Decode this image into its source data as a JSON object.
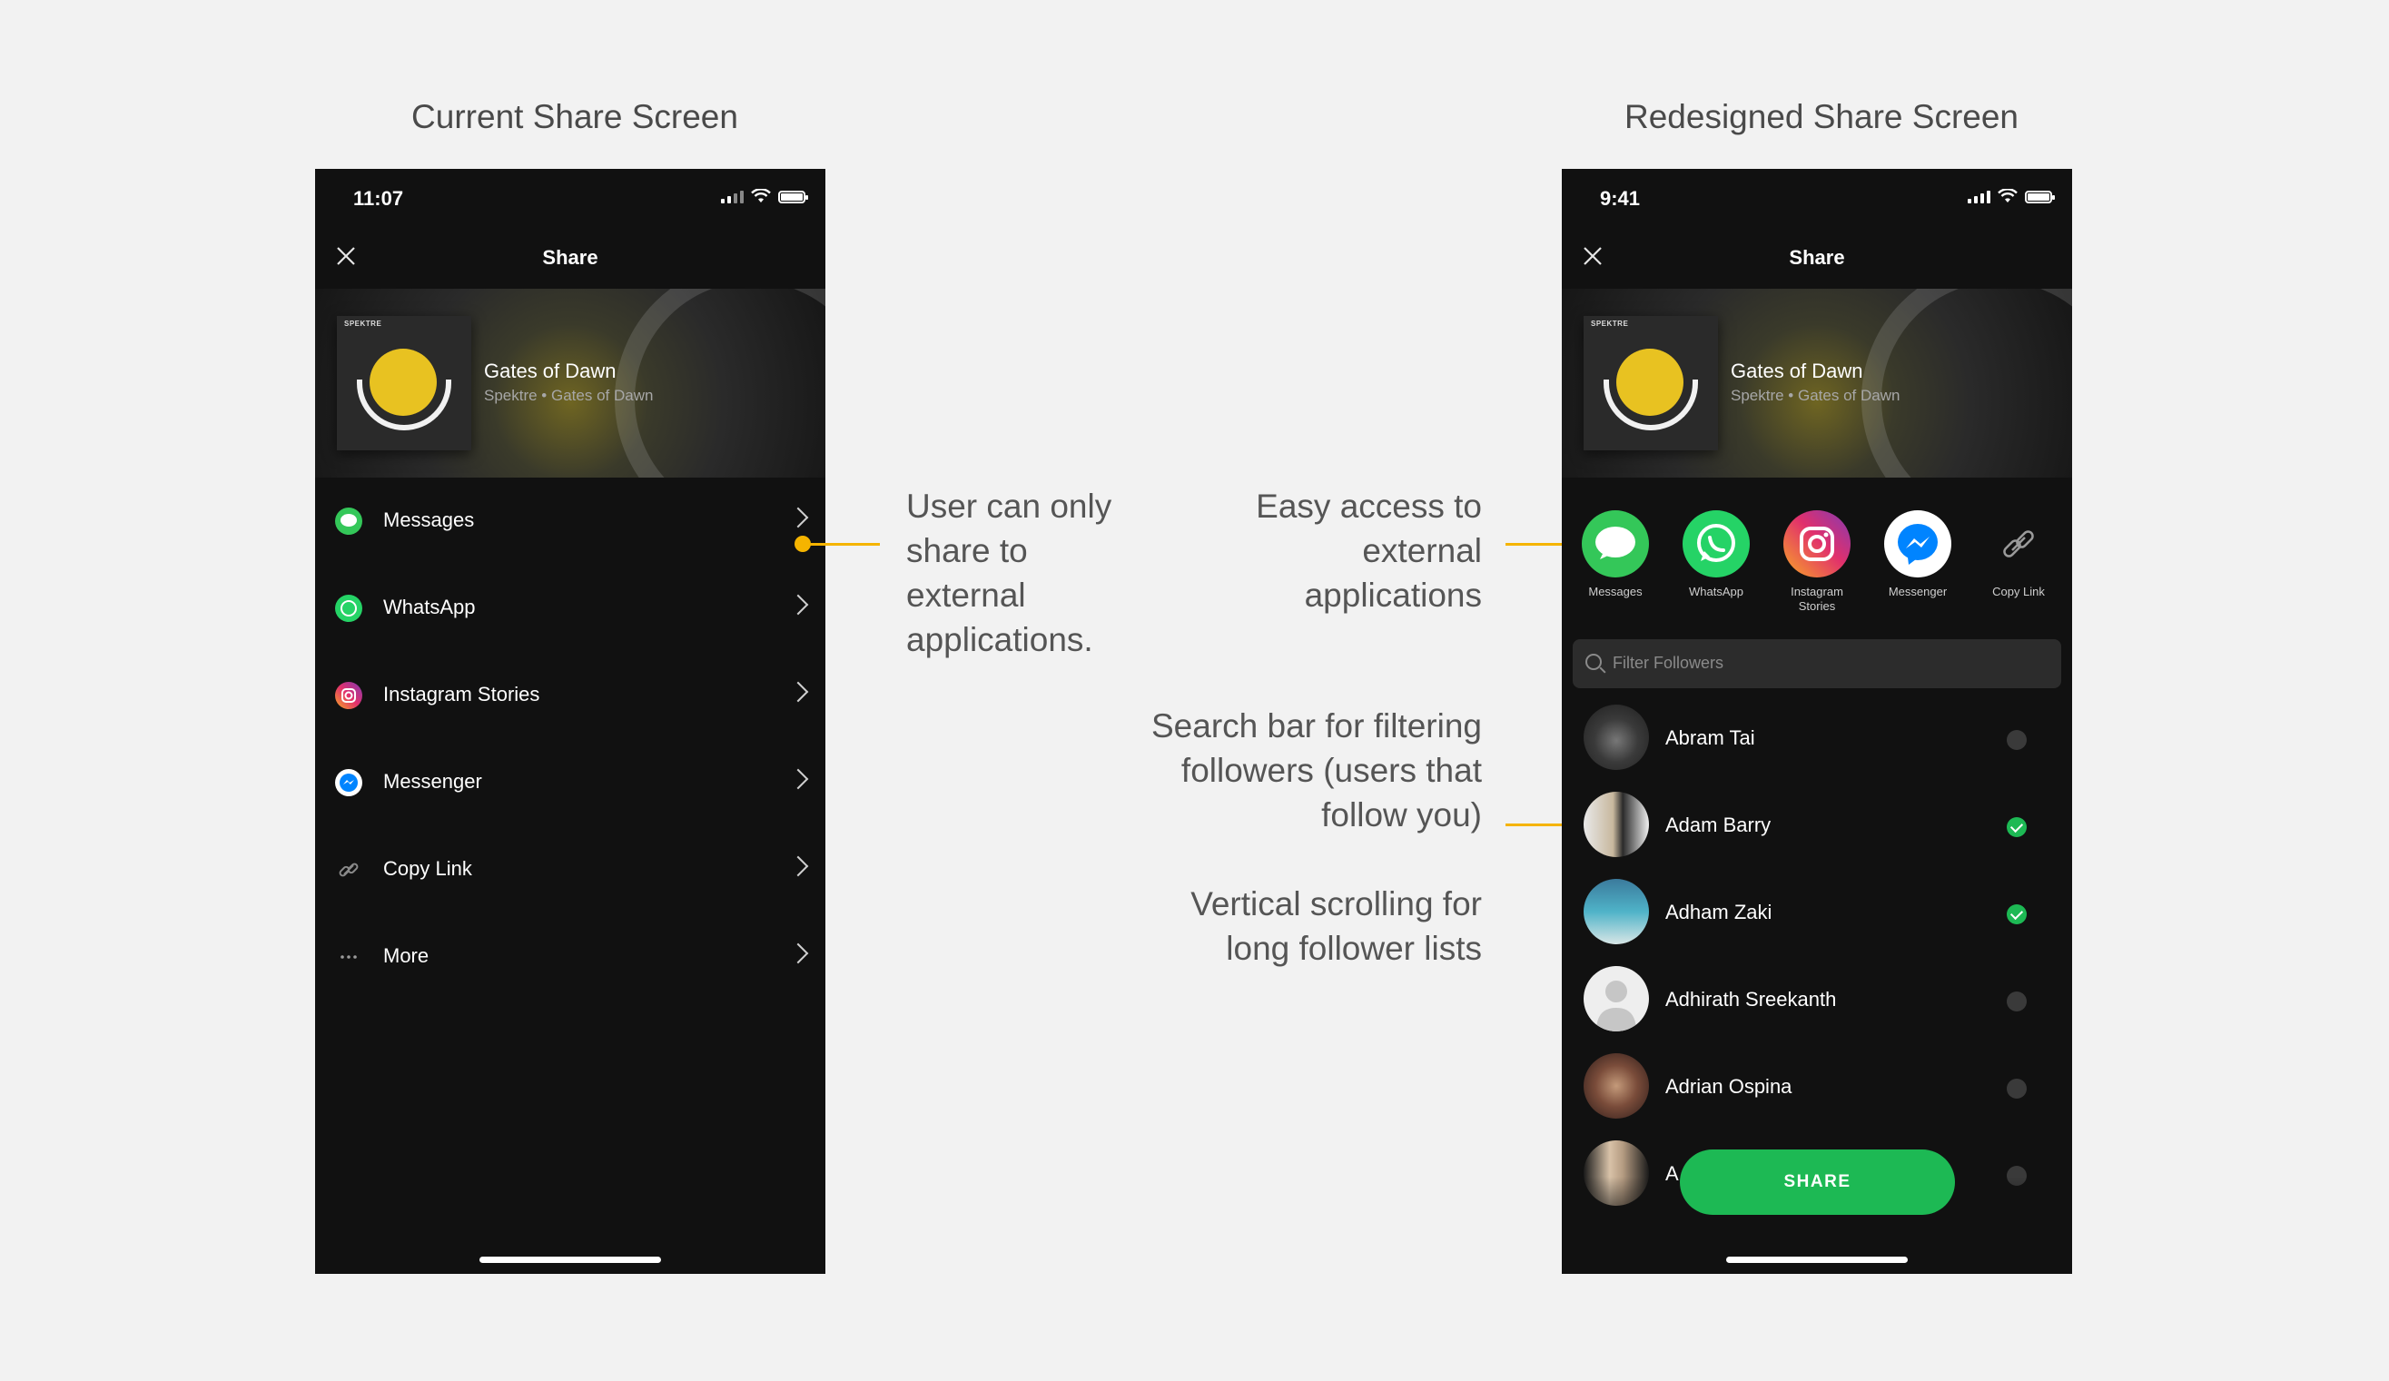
{
  "headings": {
    "current": "Current Share Screen",
    "redesigned": "Redesigned Share Screen"
  },
  "current_phone": {
    "time": "11:07",
    "title": "Share",
    "track": {
      "title": "Gates of Dawn",
      "subtitle": "Spektre • Gates of Dawn",
      "cover_brand": "SPEKTRE"
    },
    "options": [
      {
        "label": "Messages",
        "icon": "messages-icon",
        "color": "#34c759"
      },
      {
        "label": "WhatsApp",
        "icon": "whatsapp-icon",
        "color": "#25d366"
      },
      {
        "label": "Instagram Stories",
        "icon": "instagram-icon",
        "color": "#e1306c"
      },
      {
        "label": "Messenger",
        "icon": "messenger-icon",
        "color": "#0084ff"
      },
      {
        "label": "Copy Link",
        "icon": "link-icon",
        "color": "#9a9a9a"
      },
      {
        "label": "More",
        "icon": "more-icon",
        "color": "#9a9a9a"
      }
    ]
  },
  "redesigned_phone": {
    "time": "9:41",
    "title": "Share",
    "track": {
      "title": "Gates of Dawn",
      "subtitle": "Spektre • Gates of Dawn",
      "cover_brand": "SPEKTRE"
    },
    "apps": [
      {
        "label": "Messages",
        "icon": "messages-icon",
        "color": "#34c759"
      },
      {
        "label": "WhatsApp",
        "icon": "whatsapp-icon",
        "color": "#25d366"
      },
      {
        "label": "Instagram Stories",
        "icon": "instagram-icon",
        "color": "#e1306c"
      },
      {
        "label": "Messenger",
        "icon": "messenger-icon",
        "color": "#0084ff"
      },
      {
        "label": "Copy Link",
        "icon": "link-icon",
        "color": "#9a9a9a"
      }
    ],
    "search_placeholder": "Filter Followers",
    "followers": [
      {
        "name": "Abram Tai",
        "selected": false
      },
      {
        "name": "Adam Barry",
        "selected": true
      },
      {
        "name": "Adham Zaki",
        "selected": true
      },
      {
        "name": "Adhirath Sreekanth",
        "selected": false
      },
      {
        "name": "Adrian Ospina",
        "selected": false
      },
      {
        "name": "A",
        "selected": false
      }
    ],
    "share_button": "SHARE"
  },
  "annotations": {
    "left": [
      "User can only",
      "share to",
      "external",
      "applications."
    ],
    "easy_access": [
      "Easy access to",
      "external",
      "applications"
    ],
    "search_bar": [
      "Search bar for filtering",
      "followers (users that",
      "follow you)"
    ],
    "scrolling": [
      "Vertical scrolling for",
      "long follower lists"
    ]
  },
  "colors": {
    "accent": "#1db954",
    "annotation": "#f5b400",
    "phone_bg": "#111111",
    "page_bg": "#f2f2f2"
  }
}
